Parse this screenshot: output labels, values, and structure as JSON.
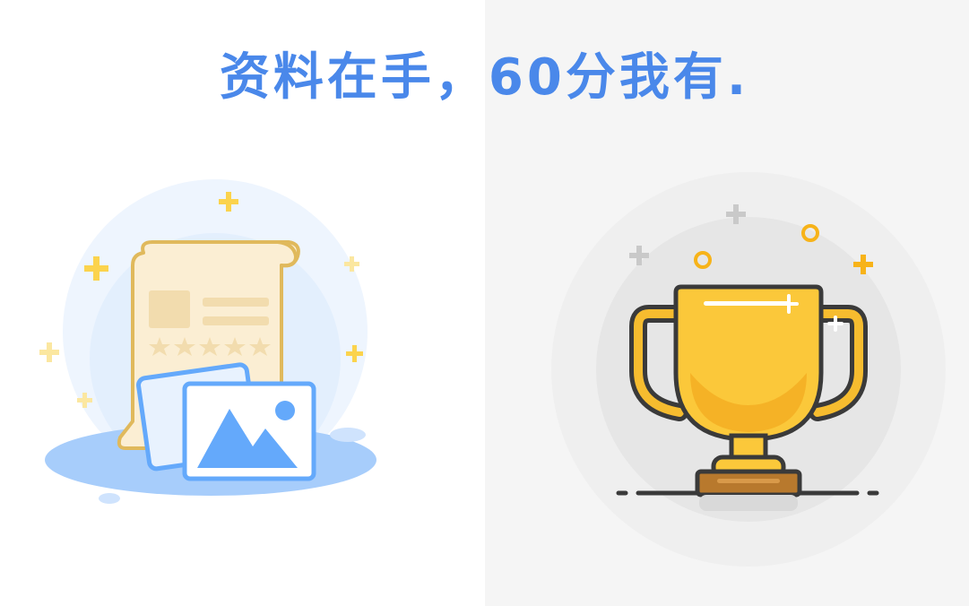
{
  "headline": {
    "text": "资料在手，60分我有."
  },
  "colors": {
    "headline": "#4a88ea",
    "left_background": "#ffffff",
    "right_background": "#f5f5f5",
    "doc_paper": "#fbeed3",
    "doc_outline": "#e0b95c",
    "photo_blue": "#64a9fb",
    "trophy_gold": "#fbc83a",
    "trophy_outline": "#3a3a3a",
    "trophy_base": "#b8792d",
    "sparkle_yellow": "#fbd34d",
    "sparkle_orange": "#f7b319",
    "sparkle_grey": "#c9c9c9"
  },
  "illustrations": {
    "left": "document-with-photos-icon",
    "right": "trophy-icon"
  }
}
